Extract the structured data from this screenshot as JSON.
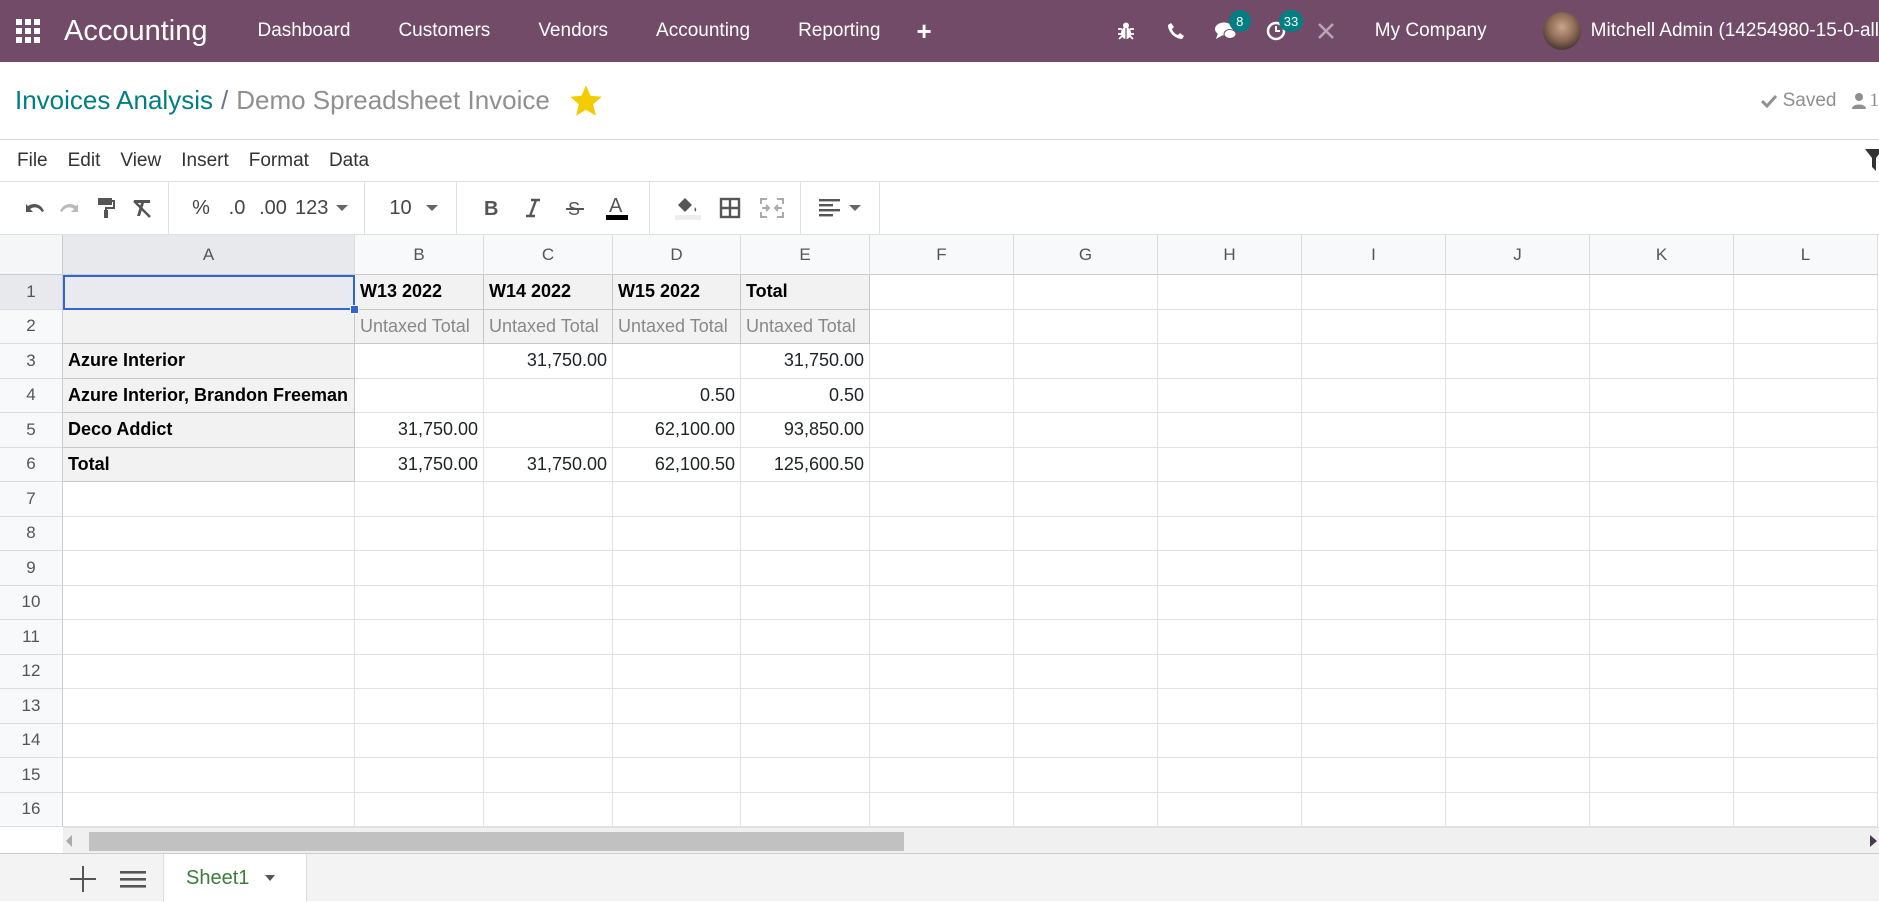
{
  "navbar": {
    "app_name": "Accounting",
    "menu": [
      "Dashboard",
      "Customers",
      "Vendors",
      "Accounting",
      "Reporting"
    ],
    "add_icon": "plus-icon",
    "icons": [
      "bug-icon",
      "phone-icon",
      "chat-icon",
      "clock-icon",
      "tools-icon"
    ],
    "messages_badge": "8",
    "activities_badge": "33",
    "company": "My Company",
    "user": "Mitchell Admin (14254980-15-0-all"
  },
  "breadcrumb": {
    "parent": "Invoices Analysis",
    "separator": "/",
    "current": "Demo Spreadsheet Invoice",
    "favorite": true,
    "favorite_color": "#f3cc00"
  },
  "status": {
    "saved_label": "Saved",
    "collaborators": "1"
  },
  "menubar": {
    "items": [
      "File",
      "Edit",
      "View",
      "Insert",
      "Format",
      "Data"
    ]
  },
  "toolbar": {
    "percent": "%",
    "decrease_decimal": ".0",
    "increase_decimal": ".00",
    "number_format": "123",
    "font_size": "10"
  },
  "spreadsheet": {
    "columns": [
      "A",
      "B",
      "C",
      "D",
      "E",
      "F",
      "G",
      "H",
      "I",
      "J",
      "K",
      "L"
    ],
    "rows": [
      "1",
      "2",
      "3",
      "4",
      "5",
      "6",
      "7",
      "8",
      "9",
      "10",
      "11",
      "12",
      "13",
      "14",
      "15",
      "16"
    ],
    "selected_cell": "A1",
    "pivot": {
      "col_headers": [
        "W13 2022",
        "W14 2022",
        "W15 2022",
        "Total"
      ],
      "measure_label": "Untaxed Total",
      "rows": [
        {
          "label": "Azure Interior",
          "values": [
            "",
            "31,750.00",
            "",
            "31,750.00"
          ]
        },
        {
          "label": "Azure Interior, Brandon Freeman",
          "values": [
            "",
            "",
            "0.50",
            "0.50"
          ]
        },
        {
          "label": "Deco Addict",
          "values": [
            "31,750.00",
            "",
            "62,100.00",
            "93,850.00"
          ]
        },
        {
          "label": "Total",
          "values": [
            "31,750.00",
            "31,750.00",
            "62,100.50",
            "125,600.50"
          ]
        }
      ]
    }
  },
  "sheets": {
    "active": "Sheet1"
  }
}
